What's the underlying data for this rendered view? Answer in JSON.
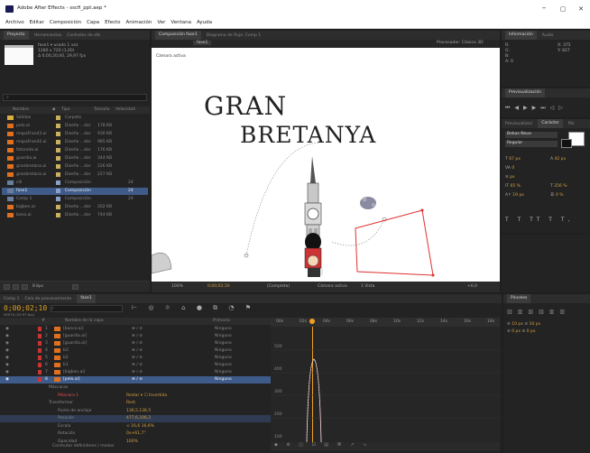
{
  "window": {
    "title": "Adobe After Effects - sscfi_ppt.aep *",
    "min": "–",
    "max": "▢",
    "close": "✕"
  },
  "menu": [
    "Archivo",
    "Editar",
    "Composición",
    "Capa",
    "Efecto",
    "Animación",
    "Ver",
    "Ventana",
    "Ayuda"
  ],
  "project": {
    "tabs": [
      "Proyecto",
      "Herramientas",
      "Controles de efe"
    ],
    "item_info": [
      "fase1 ▾ usado 1 vez",
      "1280 x 720 (1,00)",
      "Δ 0;00;20;00, 29,97 fps"
    ],
    "search_placeholder": "⌕",
    "columns": [
      "Nombre",
      "◆",
      "Tipo",
      "Tamaño",
      "Velocidad"
    ],
    "items": [
      {
        "name": "Sólidos",
        "type": "Carpeta",
        "size": "",
        "rate": "",
        "kind": "folder"
      },
      {
        "name": "pelo.ai",
        "type": "Diseño ...dor",
        "size": "178 KB",
        "rate": "",
        "kind": "ai"
      },
      {
        "name": "mapaFrand3.ai",
        "type": "Diseño ...dor",
        "size": "930 KB",
        "rate": "",
        "kind": "ai"
      },
      {
        "name": "mapaFrand2.ai",
        "type": "Diseño ...dor",
        "size": "985 KB",
        "rate": "",
        "kind": "ai"
      },
      {
        "name": "fotoroda.ai",
        "type": "Diseño ...dor",
        "size": "176 KB",
        "rate": "",
        "kind": "ai"
      },
      {
        "name": "guardia.ai",
        "type": "Diseño ...dor",
        "size": "344 KB",
        "rate": "",
        "kind": "ai"
      },
      {
        "name": "granbretana.ai",
        "type": "Diseño ...dor",
        "size": "226 KB",
        "rate": "",
        "kind": "ai"
      },
      {
        "name": "granbretana.ai",
        "type": "Diseño ...dor",
        "size": "227 KB",
        "rate": "",
        "kind": "ai"
      },
      {
        "name": "cili",
        "type": "Composición",
        "size": "",
        "rate": "24",
        "kind": "comp"
      },
      {
        "name": "fase1",
        "type": "Composición",
        "size": "",
        "rate": "24",
        "kind": "comp",
        "selected": true
      },
      {
        "name": "Comp 1",
        "type": "Composición",
        "size": "",
        "rate": "24",
        "kind": "comp"
      },
      {
        "name": "bigben.ai",
        "type": "Diseño ...dor",
        "size": "202 KB",
        "rate": "",
        "kind": "ai"
      },
      {
        "name": "bano.ai",
        "type": "Diseño ...dor",
        "size": "744 KB",
        "rate": "",
        "kind": "ai"
      }
    ],
    "bpc": "8 bpc"
  },
  "composition": {
    "tabs": [
      "Composición fase1",
      "Diagrama de flujo: Comp 1"
    ],
    "subtab": "fase1",
    "renderer": "Procesador: Clásico 3D",
    "canvas_label": "Cámara activa",
    "title_line1": "GRAN",
    "title_line2": "BRETANYA",
    "footer": [
      "100%",
      "0;00;02;10",
      "(Completa)",
      "Cámara activa",
      "1 Vista",
      "+0,0"
    ]
  },
  "info": {
    "tabs": [
      "Información",
      "Audio"
    ],
    "r": "R:",
    "g": "G:",
    "b": "B:",
    "a": "A: 0",
    "x": "X: 375",
    "y": "Y: 827"
  },
  "preview": {
    "tabs": [
      "Previsualización"
    ]
  },
  "character": {
    "tabs": [
      "Previsualizaci",
      "Carácter",
      "Pár"
    ],
    "font": "Bebas Neue",
    "style": "Regular",
    "size": "67 px",
    "leading": "42 px",
    "tracking": "0",
    "unit": "px",
    "scale_v": "65 %",
    "scale_h": "256 %",
    "baseline": "19 px",
    "tsume": "0 %"
  },
  "paragraph": {
    "tabs": [
      "Párrafo"
    ],
    "indent1": "0 px",
    "indent2": "0 px",
    "space1": "0 px",
    "space2": "0 px"
  },
  "timeline": {
    "tabs": [
      "Comp 1",
      "Cola de procesamiento",
      "fase1"
    ],
    "timecode": "0;00;02;10",
    "fps_info": "00070 (29.97 fps)",
    "columns": [
      "#",
      "Nombre de la capa",
      "Primario"
    ],
    "layers": [
      {
        "num": "1",
        "name": "[banco.ai]",
        "color": "#c33",
        "parent": "Ninguno"
      },
      {
        "num": "2",
        "name": "[guardia.ai]",
        "color": "#c33",
        "parent": "Ninguno"
      },
      {
        "num": "3",
        "name": "[guardia.ai]",
        "color": "#c33",
        "parent": "Ninguno"
      },
      {
        "num": "4",
        "name": "b3",
        "color": "#c33",
        "parent": "Ninguno"
      },
      {
        "num": "5",
        "name": "b2",
        "color": "#c33",
        "parent": "Ninguno"
      },
      {
        "num": "6",
        "name": "b1",
        "color": "#c33",
        "parent": "Ninguno"
      },
      {
        "num": "7",
        "name": "[bigben.ai]",
        "color": "#c33",
        "parent": "Ninguno"
      },
      {
        "num": "8",
        "name": "[pelo.ai]",
        "color": "#c33",
        "parent": "Ninguno",
        "selected": true
      }
    ],
    "props": [
      {
        "label": "Máscaras",
        "value": "",
        "indent": 0
      },
      {
        "label": "Máscara 1",
        "value": "Restar ▾ ☐ Invertida",
        "indent": 1,
        "color": "#c00"
      },
      {
        "label": "Transformar",
        "value": "Rest.",
        "indent": 0
      },
      {
        "label": "Punto de anclaje",
        "value": "136,5,136,5",
        "indent": 1
      },
      {
        "label": "Posición",
        "value": "477,6,106,2",
        "indent": 1,
        "highlight": true
      },
      {
        "label": "Escala",
        "value": "∞ 16,6 16,6%",
        "indent": 1
      },
      {
        "label": "Rotación",
        "value": "0x+61,7°",
        "indent": 1
      },
      {
        "label": "Opacidad",
        "value": "100%",
        "indent": 1
      }
    ],
    "ruler": [
      "00s",
      "02s",
      "04s",
      "06s",
      "08s",
      "10s",
      "12s",
      "14s",
      "16s",
      "18s"
    ],
    "graph_labels": [
      "500",
      "400",
      "300",
      "200",
      "100"
    ],
    "toggle": "Conmutar definidores / modos"
  },
  "align": {
    "tabs": [
      "Pinceles"
    ],
    "a": "10 px",
    "b": "10 px",
    "c": "0 px",
    "d": "0 px"
  },
  "colors": {
    "accent": "#f0a020",
    "selection": "#3e5b8a",
    "label_red": "#c33333"
  }
}
